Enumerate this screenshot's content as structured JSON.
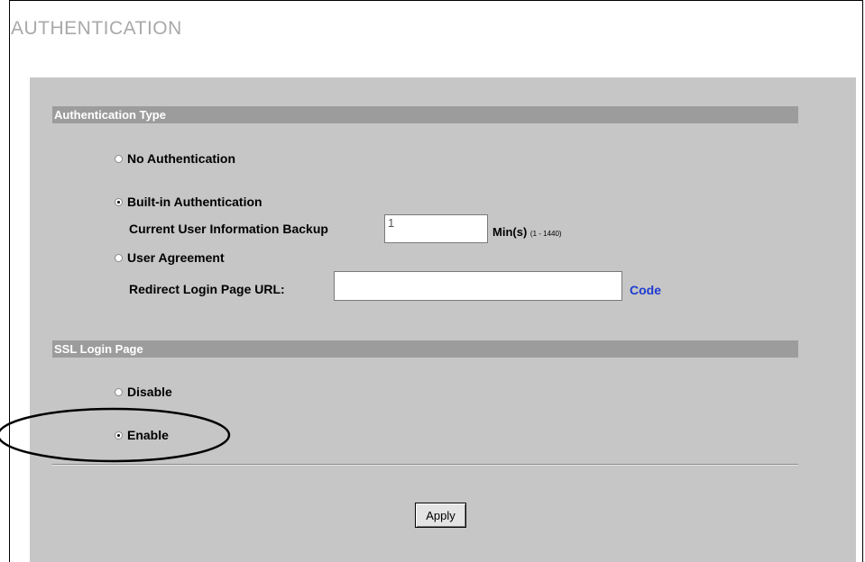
{
  "page": {
    "title": "AUTHENTICATION"
  },
  "auth_type": {
    "header": "Authentication Type",
    "no_auth_label": "No Authentication",
    "builtin_label": "Built-in Authentication",
    "backup_label": "Current User Information Backup",
    "backup_value": "1",
    "backup_unit": "Min(s)",
    "backup_range": "(1 - 1440)",
    "user_agreement_label": "User Agreement",
    "redirect_label": "Redirect Login Page URL:",
    "redirect_value": "",
    "code_link": "Code",
    "selected": "builtin"
  },
  "ssl": {
    "header": "SSL Login Page",
    "disable_label": "Disable",
    "enable_label": "Enable",
    "selected": "enable"
  },
  "actions": {
    "apply_label": "Apply"
  },
  "colors": {
    "panel_bg": "#c6c6c6",
    "section_bar": "#9c9c9c",
    "link": "#1f3bd1",
    "callout": "#000000"
  },
  "annotation": {
    "type": "callout-ellipse",
    "target": "ssl-enable-option"
  }
}
